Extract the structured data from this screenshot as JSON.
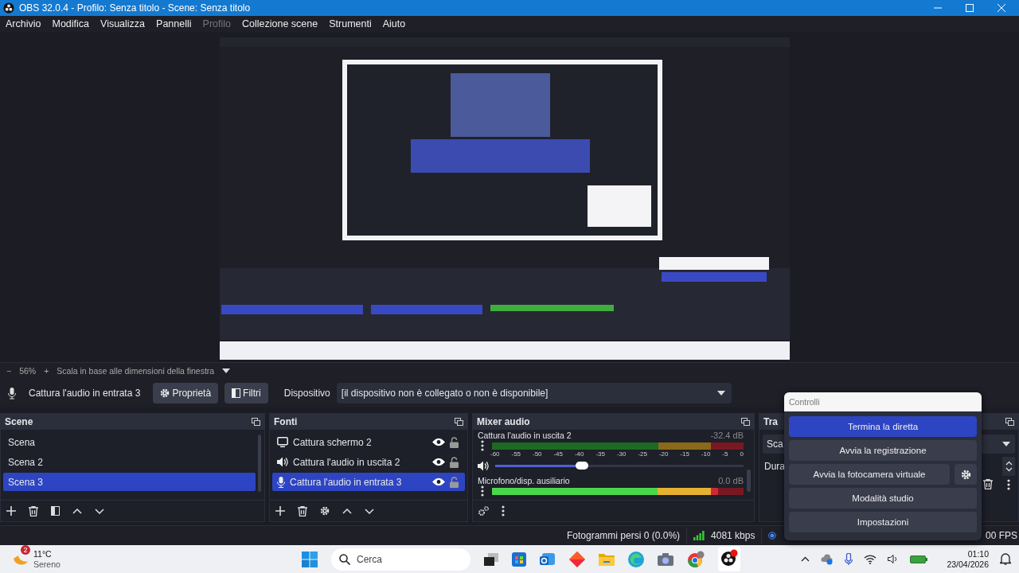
{
  "window": {
    "title": "OBS 32.0.4 - Profilo: Senza titolo - Scene: Senza titolo"
  },
  "menu": [
    {
      "label": "Archivio",
      "disabled": false
    },
    {
      "label": "Modifica",
      "disabled": false
    },
    {
      "label": "Visualizza",
      "disabled": false
    },
    {
      "label": "Pannelli",
      "disabled": false
    },
    {
      "label": "Profilo",
      "disabled": true
    },
    {
      "label": "Collezione scene",
      "disabled": false
    },
    {
      "label": "Strumenti",
      "disabled": false
    },
    {
      "label": "Aiuto",
      "disabled": false
    }
  ],
  "zoom_bar": {
    "minus": "−",
    "zoom": "56%",
    "plus": "+",
    "scale_mode": "Scala in base alle dimensioni della finestra"
  },
  "context_bar": {
    "source": "Cattura l'audio in entrata 3",
    "properties": "Proprietà",
    "filters": "Filtri",
    "device_label": "Dispositivo",
    "device": "[il dispositivo non è collegato o non è disponibile]"
  },
  "scenes": {
    "title": "Scene",
    "items": [
      {
        "label": "Scena",
        "selected": false
      },
      {
        "label": "Scena 2",
        "selected": false
      },
      {
        "label": "Scena 3",
        "selected": true
      }
    ]
  },
  "sources": {
    "title": "Fonti",
    "items": [
      {
        "label": "Cattura schermo 2",
        "kind": "display",
        "selected": false,
        "visible": true,
        "locked": false
      },
      {
        "label": "Cattura l'audio in uscita 2",
        "kind": "speaker",
        "selected": false,
        "visible": true,
        "locked": false
      },
      {
        "label": "Cattura l'audio in entrata 3",
        "kind": "mic",
        "selected": true,
        "visible": true,
        "locked": false
      }
    ]
  },
  "mixer": {
    "title": "Mixer audio",
    "scale": [
      "-60",
      "-55",
      "-50",
      "-45",
      "-40",
      "-35",
      "-30",
      "-25",
      "-20",
      "-15",
      "-10",
      "-5",
      "0"
    ],
    "channels": [
      {
        "name": "Cattura l'audio in uscita 2",
        "reading": "-32.4 dB",
        "volume": {
          "level": 0.35
        }
      },
      {
        "name": "Microfono/disp. ausiliario",
        "reading": "0.0 dB",
        "meter": {
          "level": 0.9
        }
      }
    ]
  },
  "transitions": {
    "title": "Tra",
    "transition": "Sca",
    "duration_label": "Dura"
  },
  "controls": {
    "title": "Controlli",
    "buttons": [
      {
        "label": "Termina la diretta",
        "active": true,
        "settings": false
      },
      {
        "label": "Avvia la registrazione",
        "active": false,
        "settings": false
      },
      {
        "label": "Avvia la fotocamera virtuale",
        "active": false,
        "settings": true
      },
      {
        "label": "Modalità studio",
        "active": false,
        "settings": false
      },
      {
        "label": "Impostazioni",
        "active": false,
        "settings": false
      }
    ]
  },
  "status_bar": {
    "dropped_frames": "Fotogrammi persi 0 (0.0%)",
    "bitrate": "4081 kbps",
    "fps": "00 FPS"
  },
  "taskbar": {
    "weather_badge": "2",
    "temperature": "11°C",
    "weather": "Sereno",
    "search_placeholder": "Cerca",
    "time": "01:10",
    "date": "23/04/2026"
  }
}
